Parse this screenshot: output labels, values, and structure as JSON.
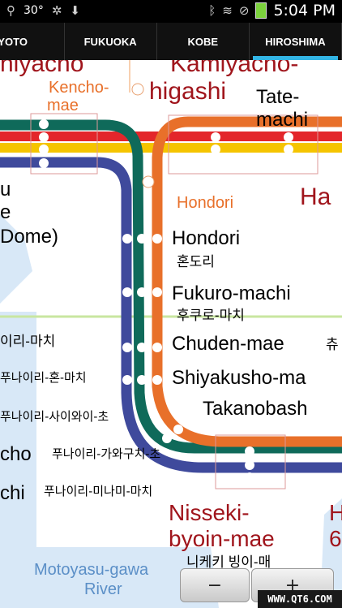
{
  "status": {
    "temp": "30°",
    "time": "5:04 PM"
  },
  "tabs": [
    "KYOTO",
    "FUKUOKA",
    "KOBE",
    "HIROSHIMA"
  ],
  "map": {
    "labels": {
      "kamiyacho_top": "Kamiyacho-",
      "higashi": "higashi",
      "hiyacho_top": "hiyacho",
      "kencho": "Kencho-",
      "mae": "mae",
      "tate": "Tate-",
      "machi": "machi",
      "hondori_orange": "Hondori",
      "ha": "Ha",
      "u": "u",
      "e": "e",
      "dome": "Dome)",
      "hondori": "Hondori",
      "hondori_kr": "혼도리",
      "fukuro": "Fukuro-machi",
      "fukuro_kr": "후쿠로-마치",
      "chuden": "Chuden-mae",
      "chuden_kr": "츄",
      "shiyakusho": "Shiyakusho-ma",
      "takanobashi": "Takanobash",
      "funairi_machi": "이리-마치",
      "funairi_hon": "푸나이리-혼-마치",
      "funairi_sai": "푸나이리-사이와이-초",
      "cho": "cho",
      "funairi_gawa": "푸나이리-가와구치-초",
      "chi": "chi",
      "funairi_mina": "푸나이리-미나미-마치",
      "nisseki": "Nisseki-",
      "byoin": "byoin-mae",
      "nisseki_kr": "니케키 빙이-매",
      "h_right": "H",
      "six_right": "6",
      "motoyasu": "Motoyasu-gawa",
      "river": "River"
    }
  },
  "zoom": {
    "minus": "−",
    "plus": "+"
  },
  "watermark": "WWW.QT6.COM"
}
